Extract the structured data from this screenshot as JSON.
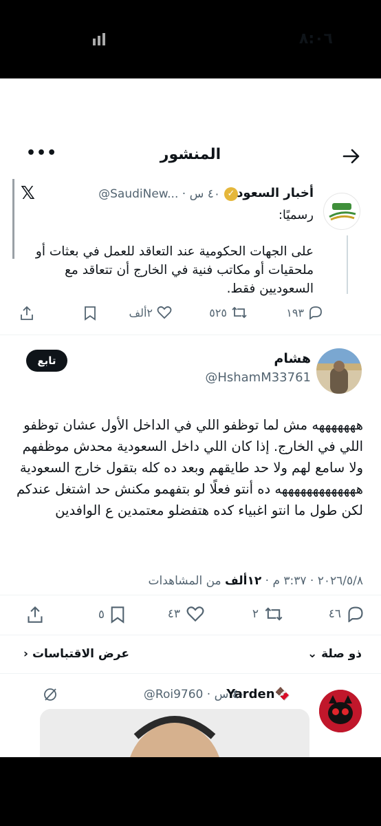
{
  "status_bar": {
    "time": "٨:٠٦"
  },
  "nav": {
    "title": "المنشور",
    "more": "•••"
  },
  "quoted_tweet": {
    "author_name": "أخبار السعودية",
    "handle": "@SaudiNew...",
    "time": "٤٠ س",
    "sub": "رسميًا:",
    "body": "على الجهات الحكومية عند التعاقد  للعمل في بعثات أو ملحقيات أو مكاتب فنية في الخارج أن تتعاقد مع السعوديين فقط.",
    "replies": "١٩٣",
    "reposts": "٥٢٥",
    "likes": "٢ألف"
  },
  "main_tweet": {
    "author_name": "هشام",
    "handle": "@HshamM33761",
    "follow_label": "تابع",
    "body": "هههههههه مش لما توظفو اللي في الداخل الأول عشان توظفو اللي في الخارج. إذا كان اللي داخل السعودية محدش موظفهم ولا سامع لهم ولا حد طايقهم وبعد ده كله بتقول خارج السعودية هههههههههههههه ده أنتو فعلًا لو بتفهمو مكنش حد اشتغل عندكم لكن طول ما انتو اغبياء كده هتفضلو معتمدين ع الوافدين",
    "date_time": "٢٠٢٦/٥/٨ · ٣:٣٧ م · ",
    "views_count": "١٢ألف",
    "views_label": " من المشاهدات",
    "replies": "٤٦",
    "reposts": "٢",
    "likes": "٤٣",
    "bookmarks": "٥",
    "related_label": "ذو صلة",
    "quotes_label": "عرض الاقتباسات"
  },
  "reply_tweet": {
    "author_name": "Yarden🍫",
    "handle": "@Roi9760",
    "time": "٤٠ س"
  },
  "colors": {
    "text": "#0f1419",
    "secondary": "#536471",
    "verified": "#e5b73b",
    "divider": "#eff3f4"
  }
}
